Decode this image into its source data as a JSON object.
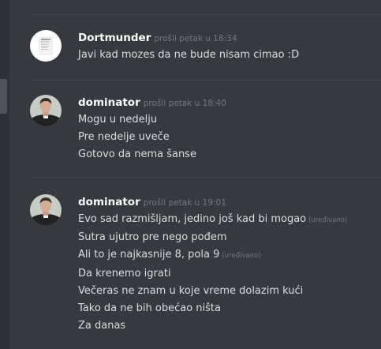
{
  "messages": [
    {
      "username": "Dortmunder",
      "timestamp": "prošli petak u 18:34",
      "avatar_icon": "document-icon",
      "lines": [
        {
          "text": "Javi kad mozes da ne bude nisam cimao :D",
          "edited": null
        }
      ]
    },
    {
      "username": "dominator",
      "timestamp": "prošli petak u 18:40",
      "avatar_icon": "priest-avatar-icon",
      "lines": [
        {
          "text": "Mogu u nedelju",
          "edited": null
        },
        {
          "text": "Pre nedelje uveče",
          "edited": null
        },
        {
          "text": "Gotovo da nema šanse",
          "edited": null
        }
      ]
    },
    {
      "username": "dominator",
      "timestamp": "prošli petak u 19:01",
      "avatar_icon": "priest-avatar-icon",
      "lines": [
        {
          "text": "Evo sad razmišljam, jedino još kad bi mogao",
          "edited": "(uređivano)"
        },
        {
          "text": "Sutra ujutro pre nego pođem",
          "edited": null
        },
        {
          "text": "Ali to je najkasnije 8, pola 9",
          "edited": "(uređivano)"
        },
        {
          "text": "Da krenemo igrati",
          "edited": null
        },
        {
          "text": "Večeras ne znam u koje vreme dolazim kući",
          "edited": null
        },
        {
          "text": "Tako da ne bih obećao ništa",
          "edited": null
        },
        {
          "text": "Za danas",
          "edited": null
        }
      ]
    }
  ],
  "colors": {
    "background": "#36393f",
    "username": "#ffffff",
    "message_text": "#dcddde",
    "muted": "#72767d"
  }
}
